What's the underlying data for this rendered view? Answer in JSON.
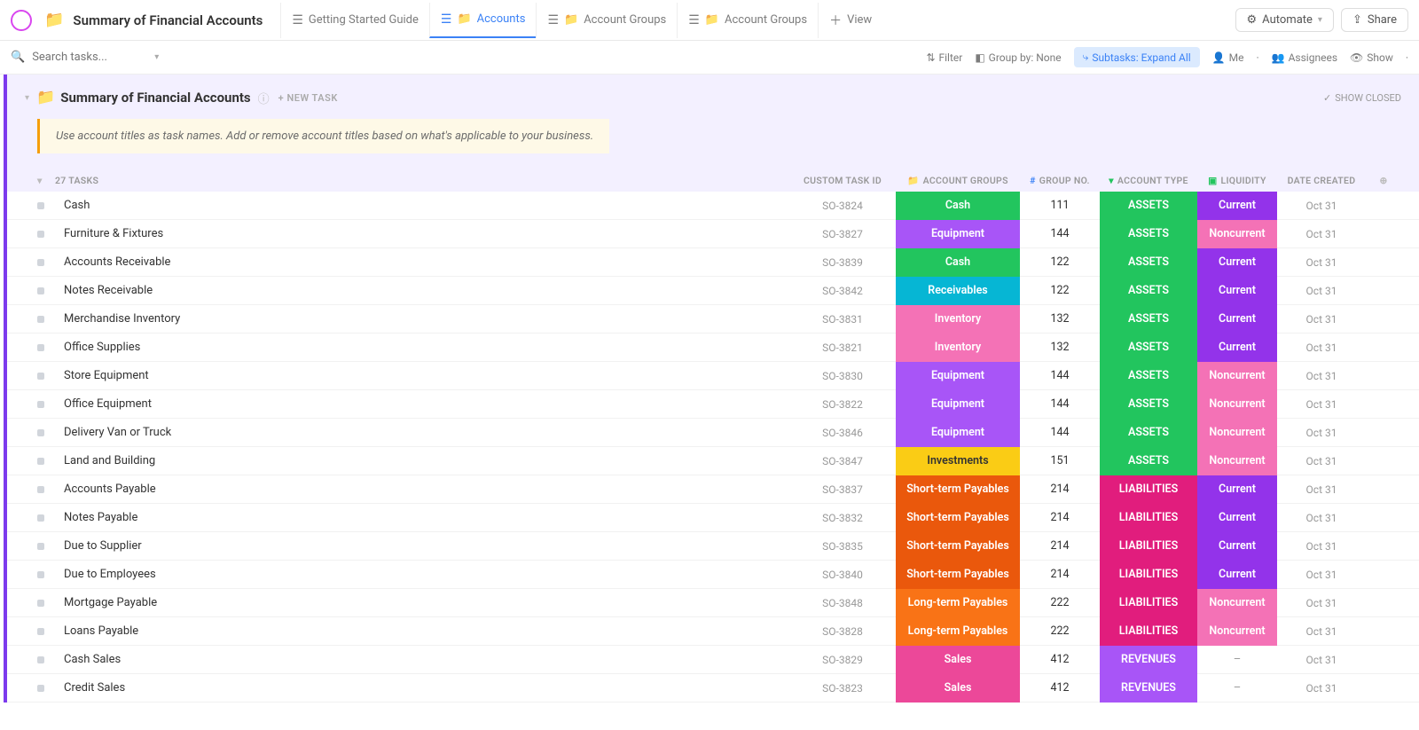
{
  "header": {
    "title": "Summary of Financial Accounts",
    "tabs": [
      {
        "label": "Getting Started Guide",
        "active": false,
        "hasFolder": false
      },
      {
        "label": "Accounts",
        "active": true,
        "hasFolder": true
      },
      {
        "label": "Account Groups",
        "active": false,
        "hasFolder": true
      },
      {
        "label": "Account Groups",
        "active": false,
        "hasFolder": true
      },
      {
        "label": "View",
        "active": false,
        "hasFolder": false,
        "isAdd": true
      }
    ],
    "automate": "Automate",
    "share": "Share"
  },
  "search": {
    "placeholder": "Search tasks..."
  },
  "toolbar": {
    "filter": "Filter",
    "groupby": "Group by: None",
    "subtasks": "Subtasks: Expand All",
    "me": "Me",
    "assignees": "Assignees",
    "show": "Show"
  },
  "list": {
    "title": "Summary of Financial Accounts",
    "newTask": "+ NEW TASK",
    "showClosed": "SHOW CLOSED",
    "banner": "Use account titles as task names. Add or remove account titles based on what's applicable to your business.",
    "taskCount": "27 TASKS"
  },
  "columns": {
    "taskId": "CUSTOM TASK ID",
    "group": "ACCOUNT GROUPS",
    "groupNo": "GROUP NO.",
    "accType": "ACCOUNT TYPE",
    "liquidity": "LIQUIDITY",
    "date": "DATE CREATED"
  },
  "colorMap": {
    "Cash": "bg-green",
    "Equipment": "bg-purple",
    "Receivables": "bg-cyan",
    "Inventory": "bg-pink",
    "Investments": "bg-yellow",
    "Short-term Payables": "bg-orange-d",
    "Long-term Payables": "bg-orange",
    "Sales": "bg-hotpink",
    "ASSETS": "bg-green",
    "LIABILITIES": "bg-magenta",
    "REVENUES": "bg-revenue",
    "Current": "bg-violet",
    "Noncurrent": "bg-hotpink2"
  },
  "rows": [
    {
      "name": "Cash",
      "id": "SO-3824",
      "group": "Cash",
      "groupNo": "111",
      "type": "ASSETS",
      "liq": "Current",
      "date": "Oct 31"
    },
    {
      "name": "Furniture & Fixtures",
      "id": "SO-3827",
      "group": "Equipment",
      "groupNo": "144",
      "type": "ASSETS",
      "liq": "Noncurrent",
      "date": "Oct 31"
    },
    {
      "name": "Accounts Receivable",
      "id": "SO-3839",
      "group": "Cash",
      "groupNo": "122",
      "type": "ASSETS",
      "liq": "Current",
      "date": "Oct 31"
    },
    {
      "name": "Notes Receivable",
      "id": "SO-3842",
      "group": "Receivables",
      "groupNo": "122",
      "type": "ASSETS",
      "liq": "Current",
      "date": "Oct 31"
    },
    {
      "name": "Merchandise Inventory",
      "id": "SO-3831",
      "group": "Inventory",
      "groupNo": "132",
      "type": "ASSETS",
      "liq": "Current",
      "date": "Oct 31"
    },
    {
      "name": "Office Supplies",
      "id": "SO-3821",
      "group": "Inventory",
      "groupNo": "132",
      "type": "ASSETS",
      "liq": "Current",
      "date": "Oct 31"
    },
    {
      "name": "Store Equipment",
      "id": "SO-3830",
      "group": "Equipment",
      "groupNo": "144",
      "type": "ASSETS",
      "liq": "Noncurrent",
      "date": "Oct 31"
    },
    {
      "name": "Office Equipment",
      "id": "SO-3822",
      "group": "Equipment",
      "groupNo": "144",
      "type": "ASSETS",
      "liq": "Noncurrent",
      "date": "Oct 31"
    },
    {
      "name": "Delivery Van or Truck",
      "id": "SO-3846",
      "group": "Equipment",
      "groupNo": "144",
      "type": "ASSETS",
      "liq": "Noncurrent",
      "date": "Oct 31"
    },
    {
      "name": "Land and Building",
      "id": "SO-3847",
      "group": "Investments",
      "groupNo": "151",
      "type": "ASSETS",
      "liq": "Noncurrent",
      "date": "Oct 31"
    },
    {
      "name": "Accounts Payable",
      "id": "SO-3837",
      "group": "Short-term Payables",
      "groupNo": "214",
      "type": "LIABILITIES",
      "liq": "Current",
      "date": "Oct 31"
    },
    {
      "name": "Notes Payable",
      "id": "SO-3832",
      "group": "Short-term Payables",
      "groupNo": "214",
      "type": "LIABILITIES",
      "liq": "Current",
      "date": "Oct 31"
    },
    {
      "name": "Due to Supplier",
      "id": "SO-3835",
      "group": "Short-term Payables",
      "groupNo": "214",
      "type": "LIABILITIES",
      "liq": "Current",
      "date": "Oct 31"
    },
    {
      "name": "Due to Employees",
      "id": "SO-3840",
      "group": "Short-term Payables",
      "groupNo": "214",
      "type": "LIABILITIES",
      "liq": "Current",
      "date": "Oct 31"
    },
    {
      "name": "Mortgage Payable",
      "id": "SO-3848",
      "group": "Long-term Payables",
      "groupNo": "222",
      "type": "LIABILITIES",
      "liq": "Noncurrent",
      "date": "Oct 31"
    },
    {
      "name": "Loans Payable",
      "id": "SO-3828",
      "group": "Long-term Payables",
      "groupNo": "222",
      "type": "LIABILITIES",
      "liq": "Noncurrent",
      "date": "Oct 31"
    },
    {
      "name": "Cash Sales",
      "id": "SO-3829",
      "group": "Sales",
      "groupNo": "412",
      "type": "REVENUES",
      "liq": "-",
      "date": "Oct 31"
    },
    {
      "name": "Credit Sales",
      "id": "SO-3823",
      "group": "Sales",
      "groupNo": "412",
      "type": "REVENUES",
      "liq": "-",
      "date": "Oct 31"
    }
  ]
}
